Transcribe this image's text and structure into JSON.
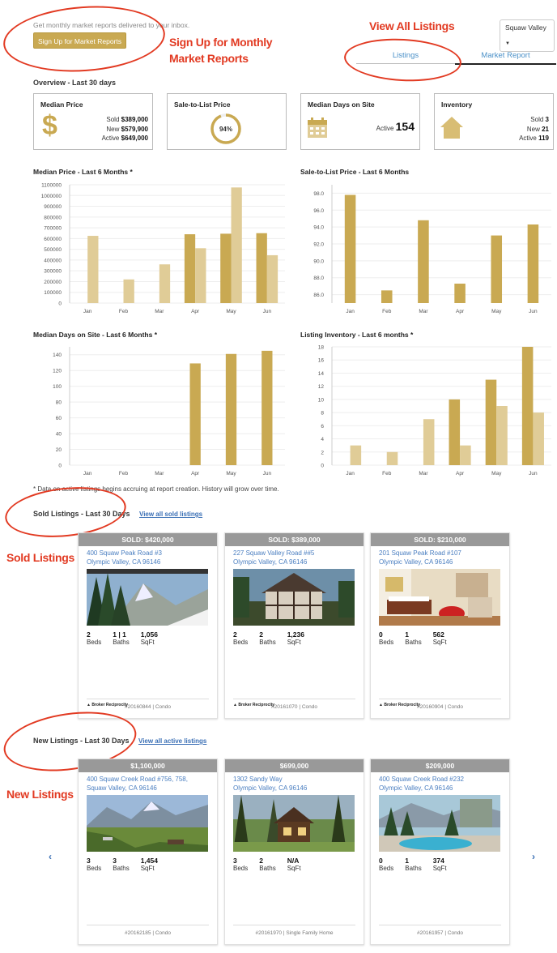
{
  "intro": {
    "text": "Get monthly market reports delivered to your inbox.",
    "signup_button": "Sign Up for Market Reports"
  },
  "annotations": {
    "signup": "Sign Up for Monthly Market Reports",
    "view_all": "View All Listings",
    "sold": "Sold Listings",
    "new": "New Listings"
  },
  "location_dropdown": {
    "value": "Squaw Valley"
  },
  "tabs": [
    {
      "label": "Listings",
      "active": true
    },
    {
      "label": "Market Report",
      "active": false
    }
  ],
  "overview": {
    "title": "Overview - Last 30 days",
    "median_price": {
      "title": "Median Price",
      "icon": "dollar-icon",
      "rows": [
        {
          "label": "Sold",
          "value": "$389,000"
        },
        {
          "label": "New",
          "value": "$579,900"
        },
        {
          "label": "Active",
          "value": "$649,000"
        }
      ]
    },
    "sale_to_list": {
      "title": "Sale-to-List Price",
      "value": "94%",
      "fraction": 0.94
    },
    "median_days": {
      "title": "Median Days on Site",
      "icon": "calendar-icon",
      "label": "Active",
      "value": "154"
    },
    "inventory": {
      "title": "Inventory",
      "icon": "house-icon",
      "rows": [
        {
          "label": "Sold",
          "value": "3"
        },
        {
          "label": "New",
          "value": "21"
        },
        {
          "label": "Active",
          "value": "119"
        }
      ]
    }
  },
  "colors": {
    "gold": "#c9a952",
    "light_gold": "#e0cc97",
    "red": "#e23a22",
    "link": "#3a6fb5"
  },
  "chart_data": [
    {
      "type": "bar",
      "title": "Median Price - Last 6 Months *",
      "categories": [
        "Jan",
        "Feb",
        "Mar",
        "Apr",
        "May",
        "Jun"
      ],
      "ylim": [
        0,
        1100000
      ],
      "yticks": [
        0,
        100000,
        200000,
        300000,
        400000,
        500000,
        600000,
        700000,
        800000,
        900000,
        1000000,
        1100000
      ],
      "series": [
        {
          "color": "#c9a952",
          "values": [
            null,
            null,
            null,
            640000,
            645000,
            650000
          ]
        },
        {
          "color": "#e0cc97",
          "values": [
            625000,
            220000,
            360000,
            510000,
            1075000,
            445000
          ]
        }
      ]
    },
    {
      "type": "bar",
      "title": "Sale-to-List Price - Last 6 Months",
      "categories": [
        "Jan",
        "Feb",
        "Mar",
        "Apr",
        "May",
        "Jun"
      ],
      "ylim": [
        85.0,
        99.0
      ],
      "yticks": [
        "86.0",
        "88.0",
        "90.0",
        "92.0",
        "94.0",
        "96.0",
        "98.0"
      ],
      "series": [
        {
          "color": "#c9a952",
          "values": [
            97.8,
            86.5,
            94.8,
            87.3,
            93.0,
            94.3
          ]
        }
      ]
    },
    {
      "type": "bar",
      "title": "Median Days on Site - Last 6 Months *",
      "categories": [
        "Jan",
        "Feb",
        "Mar",
        "Apr",
        "May",
        "Jun"
      ],
      "ylim": [
        0,
        150
      ],
      "yticks": [
        0,
        20,
        40,
        60,
        80,
        100,
        120,
        140
      ],
      "series": [
        {
          "color": "#c9a952",
          "values": [
            null,
            null,
            null,
            129,
            141,
            145
          ]
        }
      ]
    },
    {
      "type": "bar",
      "title": "Listing Inventory - Last 6 months *",
      "categories": [
        "Jan",
        "Feb",
        "Mar",
        "Apr",
        "May",
        "Jun"
      ],
      "ylim": [
        0,
        18
      ],
      "yticks": [
        0,
        2,
        4,
        6,
        8,
        10,
        12,
        14,
        16,
        18
      ],
      "series": [
        {
          "color": "#c9a952",
          "values": [
            null,
            null,
            null,
            10,
            13,
            18
          ]
        },
        {
          "color": "#e0cc97",
          "values": [
            3,
            2,
            7,
            3,
            9,
            8
          ]
        }
      ]
    }
  ],
  "footnote": "* Data on active listings begins accruing at report creation. History will grow over time.",
  "sold": {
    "title": "Sold Listings - Last 30 Days",
    "link": "View all sold listings",
    "listings": [
      {
        "price": "SOLD: $420,000",
        "addr1": "400 Squaw Peak Road #3",
        "addr2": "Olympic Valley, CA 96146",
        "addr3": "",
        "beds": "2",
        "baths": "1 | 1",
        "sqft": "1,056",
        "mls": "#20160844 | Condo",
        "photo": "mountain-snow"
      },
      {
        "price": "SOLD: $389,000",
        "addr1": "227 Squaw Valley Road ##5",
        "addr2": "Olympic Valley, CA 96146",
        "addr3": "",
        "beds": "2",
        "baths": "2",
        "sqft": "1,236",
        "mls": "#20161070 | Condo",
        "photo": "tudor-house"
      },
      {
        "price": "SOLD: $210,000",
        "addr1": "201 Squaw Peak Road #107",
        "addr2": "Olympic Valley, CA 96146",
        "addr3": "",
        "beds": "0",
        "baths": "1",
        "sqft": "562",
        "mls": "#20160904 | Condo",
        "photo": "hotel-room"
      }
    ]
  },
  "new": {
    "title": "New Listings - Last 30 Days",
    "link": "View all active listings",
    "listings": [
      {
        "price": "$1,100,000",
        "addr1": "400 Squaw Creek Road #756, 758,",
        "addr2": "Squaw Valley, CA 96146",
        "addr3": "",
        "beds": "3",
        "baths": "3",
        "sqft": "1,454",
        "mls": "#20162185 | Condo",
        "photo": "valley"
      },
      {
        "price": "$699,000",
        "addr1": "1302 Sandy Way",
        "addr2": "Olympic Valley, CA 96146",
        "addr3": "",
        "beds": "3",
        "baths": "2",
        "sqft": "N/A",
        "mls": "#20161970 | Single Family Home",
        "photo": "cabin"
      },
      {
        "price": "$209,000",
        "addr1": "400 Squaw Creek Road #232",
        "addr2": "Olympic Valley, CA 96146",
        "addr3": "",
        "beds": "0",
        "baths": "1",
        "sqft": "374",
        "mls": "#20161957 | Condo",
        "photo": "resort-pool"
      }
    ]
  },
  "labels": {
    "beds": "Beds",
    "baths": "Baths",
    "sqft": "SqFt",
    "broker": "Broker Reciprocity"
  }
}
